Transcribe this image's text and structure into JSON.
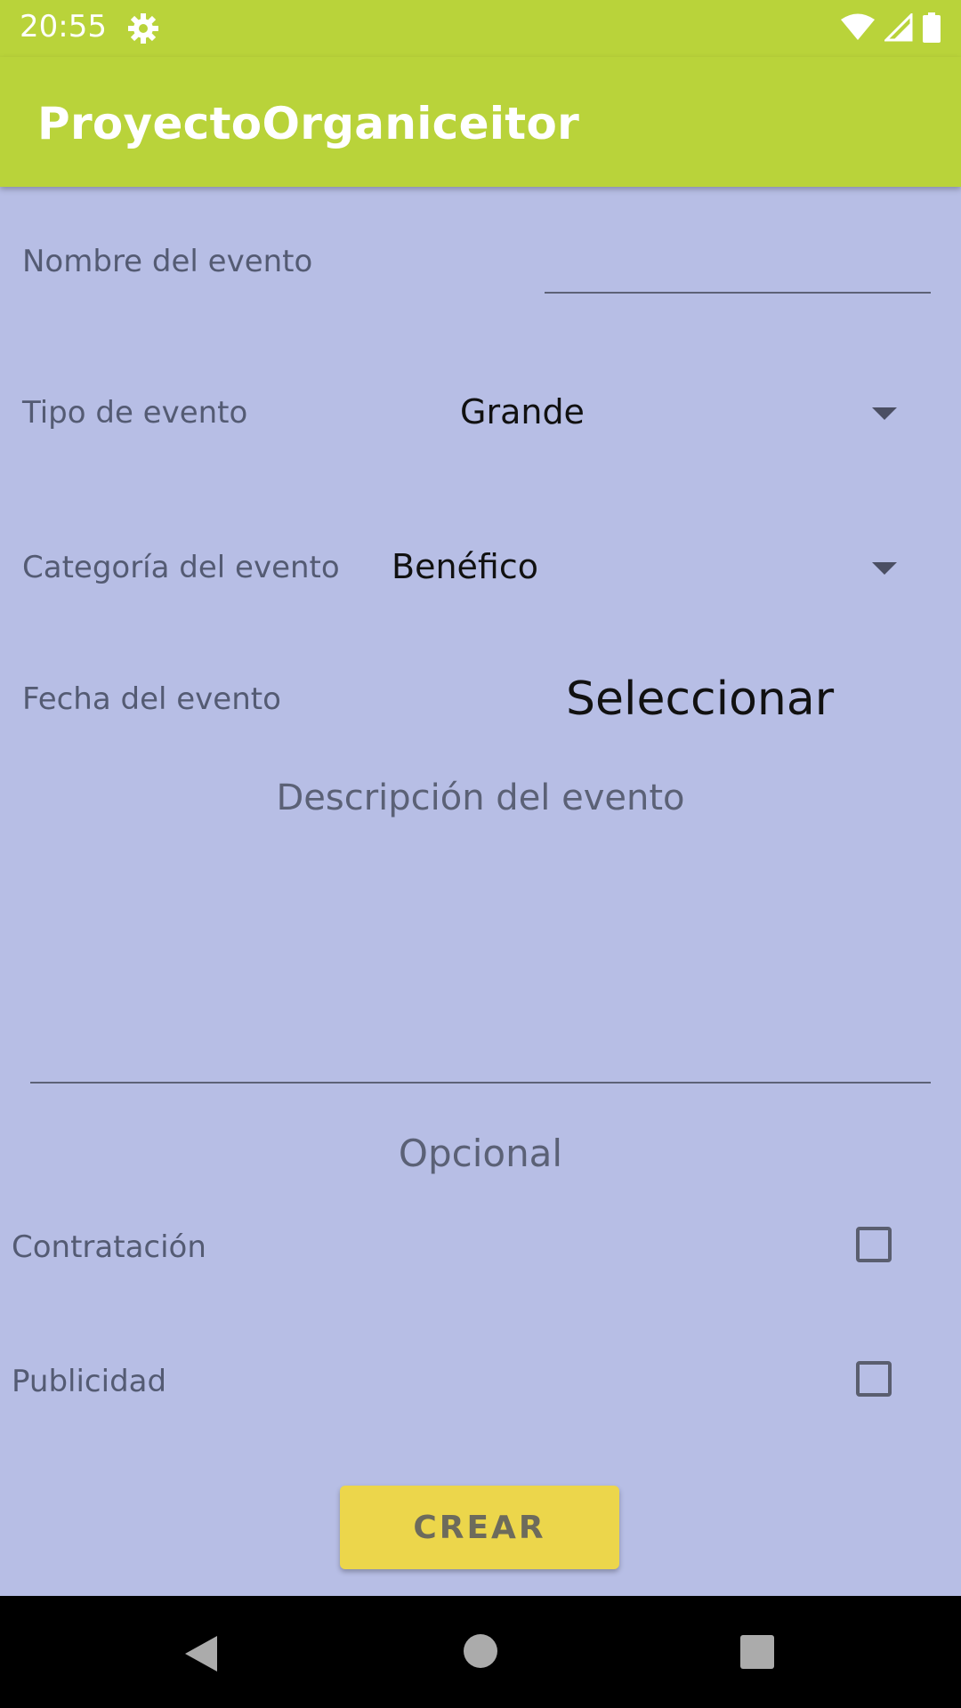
{
  "status_bar": {
    "time": "20:55"
  },
  "app_bar": {
    "title": "ProyectoOrganiceitor",
    "color": "#b9d33a"
  },
  "form": {
    "nombre_label": "Nombre del evento",
    "nombre_value": "",
    "tipo_label": "Tipo de evento",
    "tipo_value": "Grande",
    "categoria_label": "Categoría del evento",
    "categoria_value": "Benéfico",
    "fecha_label": "Fecha del evento",
    "fecha_button": "Seleccionar",
    "descripcion_hint": "Descripción del evento",
    "opcional_title": "Opcional",
    "contratacion_label": "Contratación",
    "contratacion_checked": false,
    "publicidad_label": "Publicidad",
    "publicidad_checked": false,
    "crear_button": "CREAR"
  },
  "icons": [
    "settings-gear-icon",
    "wifi-icon",
    "signal-icon",
    "battery-icon",
    "chevron-down-icon",
    "back-icon",
    "home-icon",
    "recents-icon"
  ],
  "colors": {
    "background": "#b7bee5",
    "button": "#ecd64b"
  }
}
